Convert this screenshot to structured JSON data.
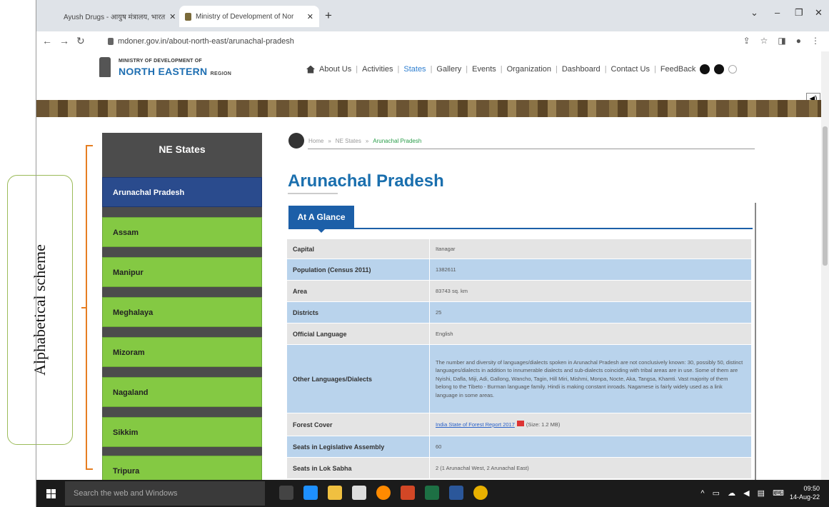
{
  "annotation": {
    "label": "Alphabetical scheme"
  },
  "browser": {
    "tabs": [
      {
        "title": "Ayush Drugs - आयुष मंत्रालय, भारत"
      },
      {
        "title": "Ministry of Development of Nor"
      }
    ],
    "url": "mdoner.gov.in/about-north-east/arunachal-pradesh"
  },
  "site": {
    "org_top": "MINISTRY OF DEVELOPMENT OF",
    "org_main": "NORTH EASTERN",
    "org_sub": "REGION",
    "nav": [
      "About Us",
      "Activities",
      "States",
      "Gallery",
      "Events",
      "Organization",
      "Dashboard",
      "Contact Us",
      "FeedBack"
    ],
    "active_nav": "States"
  },
  "sidebar": {
    "title": "NE States",
    "items": [
      {
        "label": "Arunachal Pradesh"
      },
      {
        "label": "Assam"
      },
      {
        "label": "Manipur"
      },
      {
        "label": "Meghalaya"
      },
      {
        "label": "Mizoram"
      },
      {
        "label": "Nagaland"
      },
      {
        "label": "Sikkim"
      },
      {
        "label": "Tripura"
      }
    ]
  },
  "breadcrumb": {
    "home": "Home",
    "level2": "NE States",
    "current": "Arunachal Pradesh"
  },
  "main": {
    "title": "Arunachal Pradesh",
    "tab": "At A Glance",
    "rows": [
      {
        "key": "Capital",
        "value": "Itanagar"
      },
      {
        "key": "Population (Census 2011)",
        "value": "1382611"
      },
      {
        "key": "Area",
        "value": "83743 sq. km"
      },
      {
        "key": "Districts",
        "value": "25"
      },
      {
        "key": "Official Language",
        "value": "English"
      },
      {
        "key": "Other Languages/Dialects",
        "value": "The number and diversity of languages/dialects spoken in Arunachal Pradesh are not conclusively known: 30, possibly 50, distinct languages/dialects in addition to innumerable dialects and sub-dialects coinciding with tribal areas are in use. Some of them are Nyishi, Dafla, Miji, Adi, Gallong, Wancho, Tagin, Hill Miri, Mishmi, Monpa, Nocte, Aka, Tangsa, Khamti. Vast majority of them belong to the Tibeto - Burman language family. Hindi is making constant inroads. Nagamese is fairly widely used as a link language in some areas."
      },
      {
        "key": "Forest Cover",
        "value": "India State of Forest Report 2017",
        "extra": "(Size: 1.2 MB)"
      },
      {
        "key": "Seats in Legislative Assembly",
        "value": "60"
      },
      {
        "key": "Seats in Lok Sabha",
        "value": "2 (1 Arunachal West, 2 Arunachal East)"
      }
    ]
  },
  "taskbar": {
    "search_placeholder": "Search the web and Windows",
    "time": "09:50",
    "date": "14-Aug-22"
  }
}
